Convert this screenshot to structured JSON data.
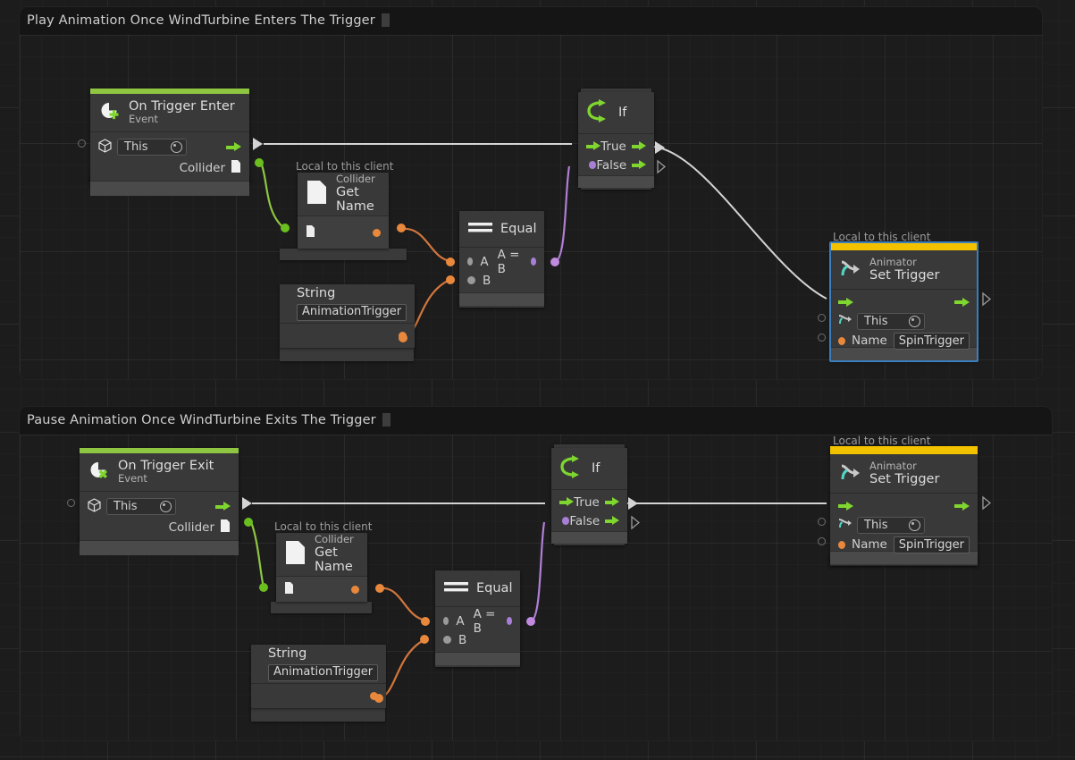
{
  "app": {
    "canvas_bg": "#1c1c1c",
    "accent_event": "#8ec642",
    "accent_animator": "#f2c200",
    "selection_color": "#3a7fbd",
    "wire_flow": "#d4d4d4",
    "wire_object": "#8ec642",
    "wire_string": "#e8883c",
    "wire_bool": "#b07fd6"
  },
  "graphs": [
    {
      "id": "graph-enter",
      "title": "Play Animation Once WindTurbine Enters The Trigger",
      "nodes": {
        "event": {
          "subtitle": "On Trigger Enter",
          "title": "Event",
          "icon": "on-trigger-enter-icon",
          "target_value": "This",
          "output_label": "Collider"
        },
        "get_name": {
          "badge": "Local to this client",
          "subtitle": "Collider",
          "title": "Get Name",
          "icon": "collider-paper-icon"
        },
        "equal": {
          "title": "Equal",
          "icon": "equal-icon",
          "input_a": "A",
          "input_b": "B",
          "output": "A = B"
        },
        "string": {
          "title": "String",
          "icon": "string-dot-icon",
          "value": "AnimationTrigger"
        },
        "if": {
          "title": "If",
          "icon": "branch-icon",
          "true_label": "True",
          "false_label": "False"
        },
        "animator": {
          "badge": "Local to this client",
          "subtitle": "Animator",
          "title": "Set Trigger",
          "icon": "animator-icon",
          "target_value": "This",
          "name_label": "Name",
          "name_value": "SpinTrigger",
          "selected": true
        }
      }
    },
    {
      "id": "graph-exit",
      "title": "Pause Animation Once WindTurbine Exits The Trigger",
      "nodes": {
        "event": {
          "subtitle": "On Trigger Exit",
          "title": "Event",
          "icon": "on-trigger-exit-icon",
          "target_value": "This",
          "output_label": "Collider"
        },
        "get_name": {
          "badge": "Local to this client",
          "subtitle": "Collider",
          "title": "Get Name",
          "icon": "collider-paper-icon"
        },
        "equal": {
          "title": "Equal",
          "icon": "equal-icon",
          "input_a": "A",
          "input_b": "B",
          "output": "A = B"
        },
        "string": {
          "title": "String",
          "icon": "string-dot-icon",
          "value": "AnimationTrigger"
        },
        "if": {
          "title": "If",
          "icon": "branch-icon",
          "true_label": "True",
          "false_label": "False"
        },
        "animator": {
          "badge": "Local to this client",
          "subtitle": "Animator",
          "title": "Set Trigger",
          "icon": "animator-icon",
          "target_value": "This",
          "name_label": "Name",
          "name_value": "SpinTrigger",
          "selected": false
        }
      }
    }
  ]
}
